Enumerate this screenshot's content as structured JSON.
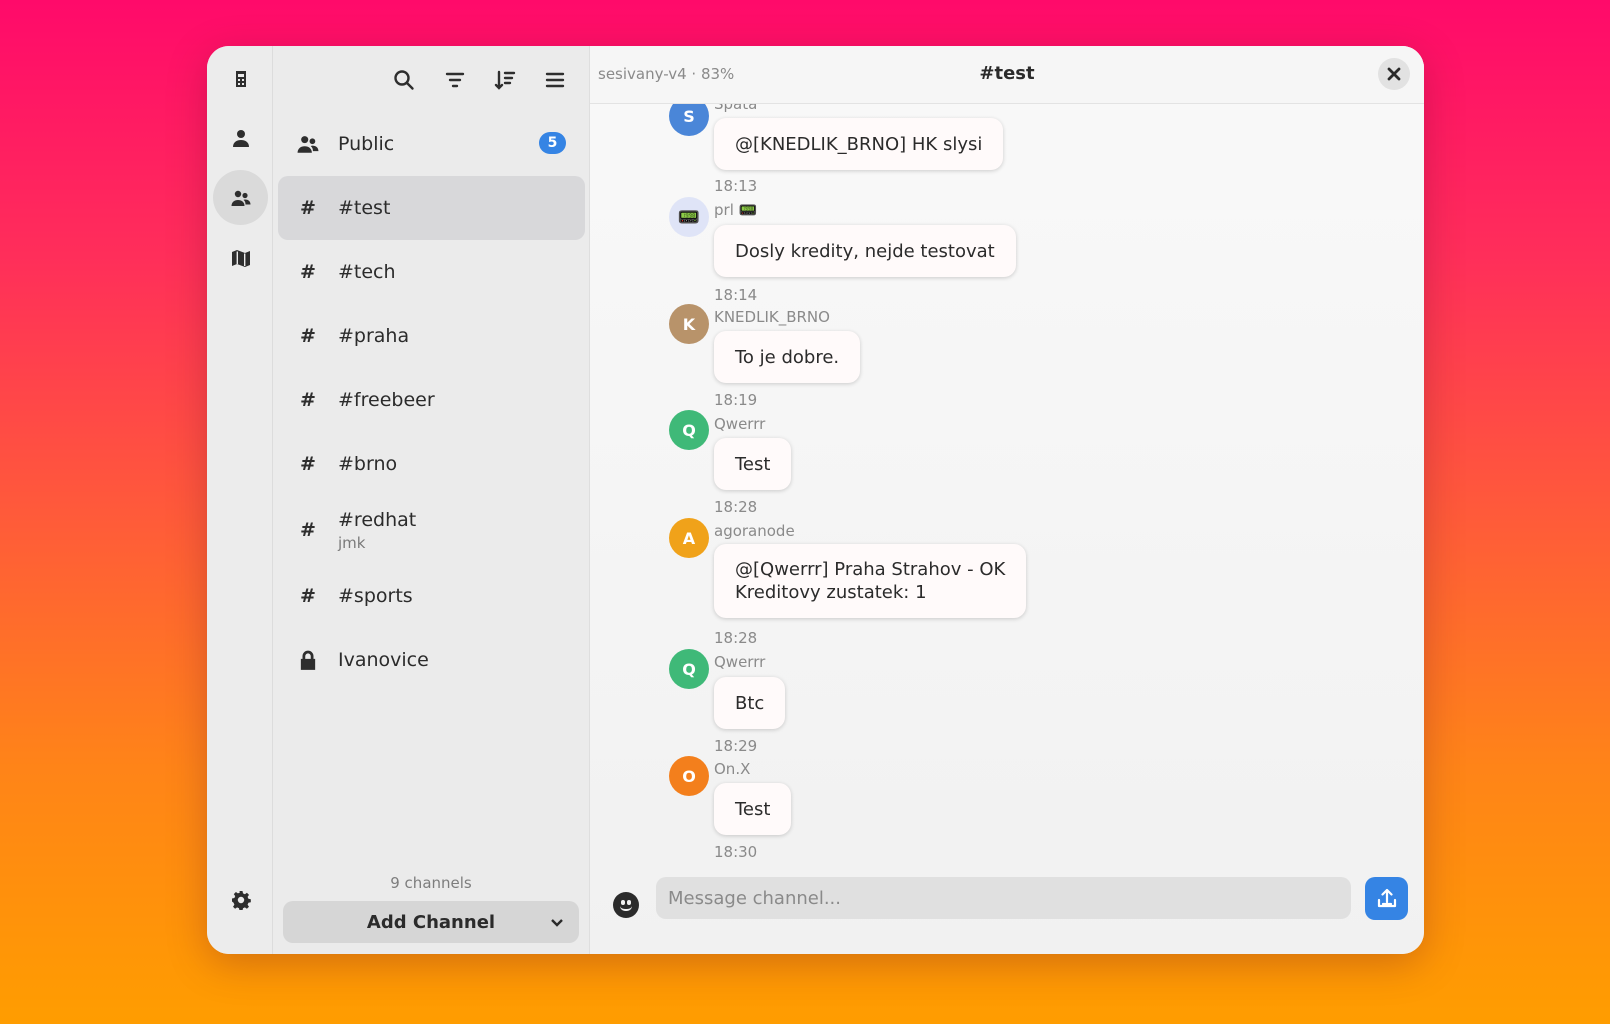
{
  "sidebar": {
    "network_status": "sesivany-v4 · 83%",
    "channels": [
      {
        "name": "Public",
        "badge": "5",
        "icon": "people-icon"
      },
      {
        "name": "#test",
        "icon": "hash-icon"
      },
      {
        "name": "#tech",
        "icon": "hash-icon"
      },
      {
        "name": "#praha",
        "icon": "hash-icon"
      },
      {
        "name": "#freebeer",
        "icon": "hash-icon"
      },
      {
        "name": "#brno",
        "icon": "hash-icon"
      },
      {
        "name": "#redhat",
        "subtitle": "jmk",
        "icon": "hash-icon"
      },
      {
        "name": "#sports",
        "icon": "hash-icon"
      },
      {
        "name": "Ivanovice",
        "icon": "lock-icon"
      }
    ],
    "hash_glyph": "#",
    "channel_count": "9 channels",
    "add_channel_label": "Add Channel"
  },
  "chat": {
    "title": "#test",
    "messages": [
      {
        "sender": "Spata",
        "initial": "S",
        "text": "@[KNEDLIK_BRNO] HK slysi",
        "time": "18:13",
        "avatar_color": "#4a86d8"
      },
      {
        "sender": "prl 📟",
        "initial": "📟",
        "text": "Dosly kredity, nejde testovat",
        "time": "18:14",
        "avatar_color": "#dfe4f7"
      },
      {
        "sender": "KNEDLIK_BRNO",
        "initial": "K",
        "text": "To je dobre.",
        "time": "18:19",
        "avatar_color": "#b8936a"
      },
      {
        "sender": "Qwerrr",
        "initial": "Q",
        "text": "Test",
        "time": "18:28",
        "avatar_color": "#3fb978"
      },
      {
        "sender": "agoranode",
        "initial": "A",
        "text": "@[Qwerrr] Praha Strahov - OK",
        "text2": "Kreditovy zustatek: 1",
        "time": "18:28",
        "avatar_color": "#f0a21a"
      },
      {
        "sender": "Qwerrr",
        "initial": "Q",
        "text": "Btc",
        "time": "18:29",
        "avatar_color": "#3fb978"
      },
      {
        "sender": "On.X",
        "initial": "O",
        "text": "Test",
        "time": "18:30",
        "avatar_color": "#f37f1c"
      }
    ],
    "composer_placeholder": "Message channel..."
  },
  "colors": {
    "accent": "#3584e4"
  }
}
